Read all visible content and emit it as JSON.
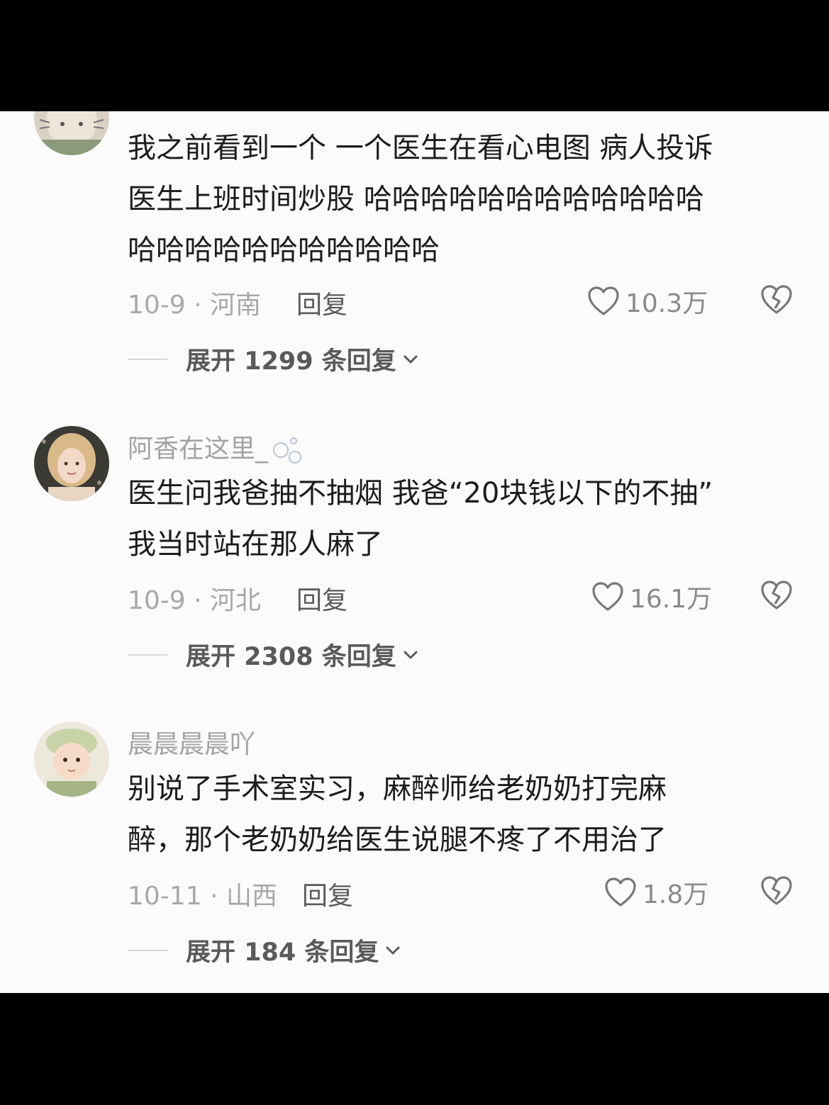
{
  "comments": [
    {
      "username": "",
      "lines": [
        "我之前看到一个 一个医生在看心电图 病人投诉",
        "医生上班时间炒股 哈哈哈哈哈哈哈哈哈哈哈哈",
        "哈哈哈哈哈哈哈哈哈哈哈"
      ],
      "date_location": "10-9 · 河南",
      "reply_label": "回复",
      "likes": "10.3万",
      "expand_label": "展开 1299 条回复",
      "avatar_icon": "cartoon-avatar"
    },
    {
      "username": "阿香在这里_",
      "lines": [
        "医生问我爸抽不抽烟 我爸“20块钱以下的不抽”",
        "我当时站在那人麻了"
      ],
      "date_location": "10-9 · 河北",
      "reply_label": "回复",
      "likes": "16.1万",
      "expand_label": "展开 2308 条回复",
      "avatar_icon": "woman-photo-avatar"
    },
    {
      "username": "晨晨晨晨吖",
      "lines": [
        "别说了手术室实习，麻醉师给老奶奶打完麻",
        "醉，那个老奶奶给医生说腿不疼了不用治了"
      ],
      "date_location": "10-11 · 山西",
      "reply_label": "回复",
      "likes": "1.8万",
      "expand_label": "展开 184 条回复",
      "avatar_icon": "baby-photo-avatar"
    }
  ],
  "icons": {
    "like": "heart-outline-icon",
    "dislike": "broken-heart-icon",
    "expand": "chevron-down-icon",
    "username_decoration": "bubbles-icon"
  },
  "colors": {
    "background": "#fbfbfb",
    "letterbox": "#000000",
    "text": "#1c1c1c",
    "muted": "#a8a8a8"
  }
}
